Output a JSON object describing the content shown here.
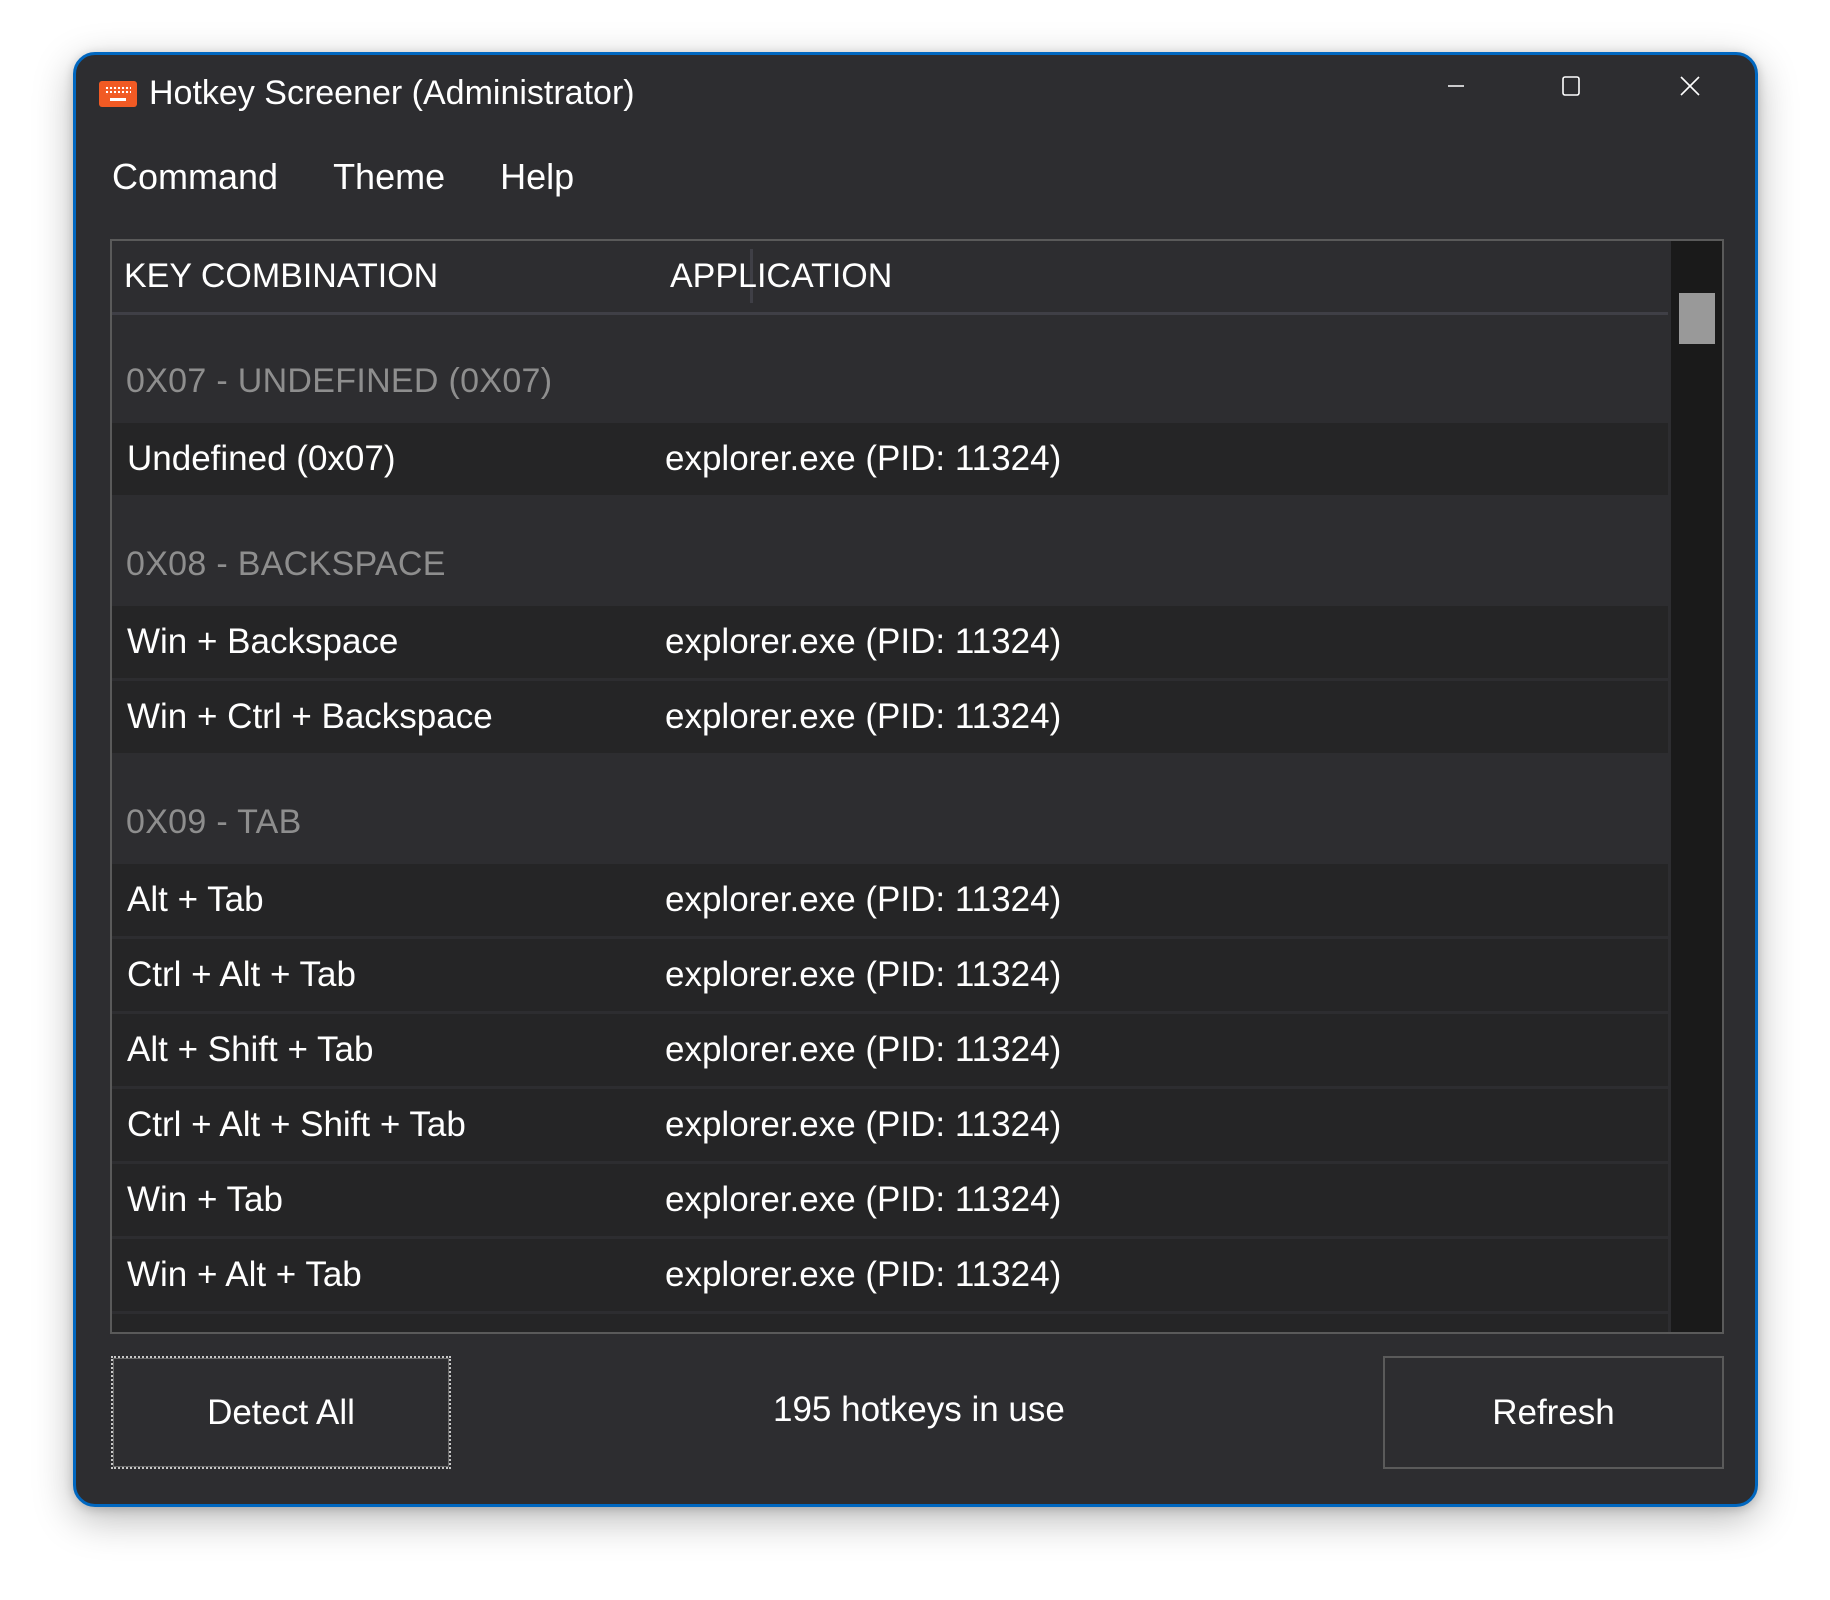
{
  "window": {
    "title": "Hotkey Screener (Administrator)",
    "app_icon": "keyboard-icon",
    "accent_color": "#0067c0",
    "controls": {
      "minimize": "minimize-icon",
      "maximize": "maximize-icon",
      "close": "close-icon"
    }
  },
  "menu": {
    "items": [
      {
        "label": "Command"
      },
      {
        "label": "Theme"
      },
      {
        "label": "Help"
      }
    ]
  },
  "list": {
    "columns": [
      {
        "label": "KEY COMBINATION"
      },
      {
        "label": "APPLICATION"
      }
    ],
    "groups": [
      {
        "header": "0X07 - UNDEFINED (0X07)",
        "rows": [
          {
            "keys": "Undefined (0x07)",
            "app": "explorer.exe (PID: 11324)"
          }
        ]
      },
      {
        "header": "0X08 - BACKSPACE",
        "rows": [
          {
            "keys": "Win + Backspace",
            "app": "explorer.exe (PID: 11324)"
          },
          {
            "keys": "Win + Ctrl + Backspace",
            "app": "explorer.exe (PID: 11324)"
          }
        ]
      },
      {
        "header": "0X09 - TAB",
        "rows": [
          {
            "keys": "Alt + Tab",
            "app": "explorer.exe (PID: 11324)"
          },
          {
            "keys": "Ctrl + Alt + Tab",
            "app": "explorer.exe (PID: 11324)"
          },
          {
            "keys": "Alt + Shift + Tab",
            "app": "explorer.exe (PID: 11324)"
          },
          {
            "keys": "Ctrl + Alt + Shift + Tab",
            "app": "explorer.exe (PID: 11324)"
          },
          {
            "keys": "Win + Tab",
            "app": "explorer.exe (PID: 11324)"
          },
          {
            "keys": "Win + Alt + Tab",
            "app": "explorer.exe (PID: 11324)"
          }
        ]
      }
    ]
  },
  "footer": {
    "detect_all_label": "Detect All",
    "status": "195 hotkeys in use",
    "refresh_label": "Refresh"
  }
}
